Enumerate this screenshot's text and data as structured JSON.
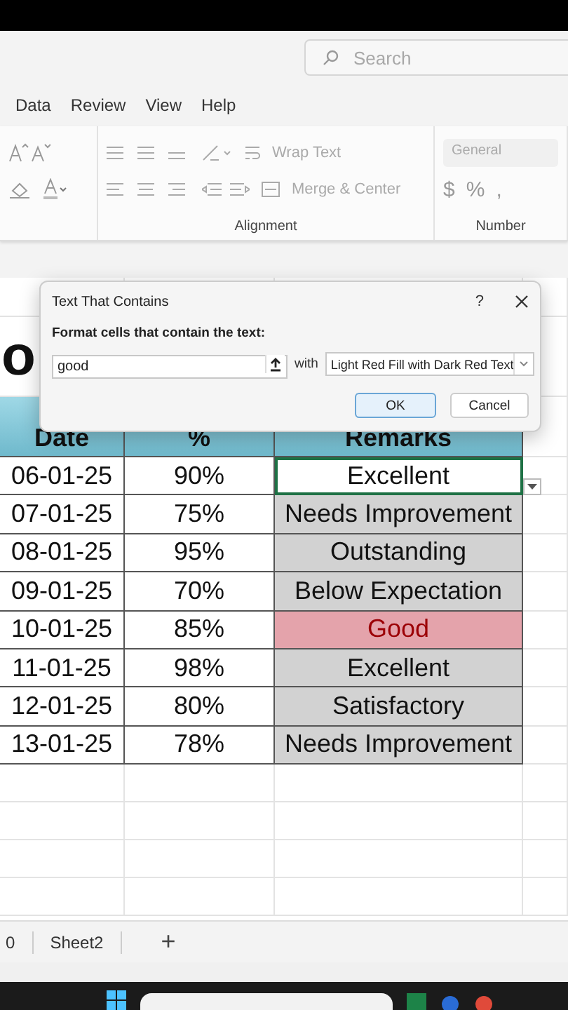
{
  "search": {
    "placeholder": "Search"
  },
  "menu_tabs": [
    {
      "label": "Data"
    },
    {
      "label": "Review"
    },
    {
      "label": "View"
    },
    {
      "label": "Help"
    }
  ],
  "ribbon": {
    "wrap_text": "Wrap Text",
    "merge_center": "Merge & Center",
    "number_format": "General",
    "currency": "$",
    "percent": "%",
    "comma": ",",
    "groups": [
      "Alignment",
      "Number"
    ]
  },
  "sheet": {
    "title_fragment": "o",
    "columns": [
      "Date",
      "%",
      "Remarks"
    ],
    "rows": [
      {
        "date": "06-01-25",
        "percent": "90%",
        "remark": "Excellent",
        "active": true,
        "match": false
      },
      {
        "date": "07-01-25",
        "percent": "75%",
        "remark": "Needs Improvement",
        "active": false,
        "match": false
      },
      {
        "date": "08-01-25",
        "percent": "95%",
        "remark": "Outstanding",
        "active": false,
        "match": false
      },
      {
        "date": "09-01-25",
        "percent": "70%",
        "remark": "Below Expectation",
        "active": false,
        "match": false
      },
      {
        "date": "10-01-25",
        "percent": "85%",
        "remark": "Good",
        "active": false,
        "match": true
      },
      {
        "date": "11-01-25",
        "percent": "98%",
        "remark": "Excellent",
        "active": false,
        "match": false
      },
      {
        "date": "12-01-25",
        "percent": "80%",
        "remark": "Satisfactory",
        "active": false,
        "match": false
      },
      {
        "date": "13-01-25",
        "percent": "78%",
        "remark": "Needs Improvement",
        "active": false,
        "match": false
      }
    ]
  },
  "dialog": {
    "title": "Text That Contains",
    "help": "?",
    "label": "Format cells that contain the text:",
    "value": "good",
    "with": "with",
    "format": "Light Red Fill with Dark Red Text",
    "ok": "OK",
    "cancel": "Cancel"
  },
  "sheet_tabs": [
    {
      "label": "0"
    },
    {
      "label": "Sheet2"
    }
  ],
  "add_sheet": "+"
}
